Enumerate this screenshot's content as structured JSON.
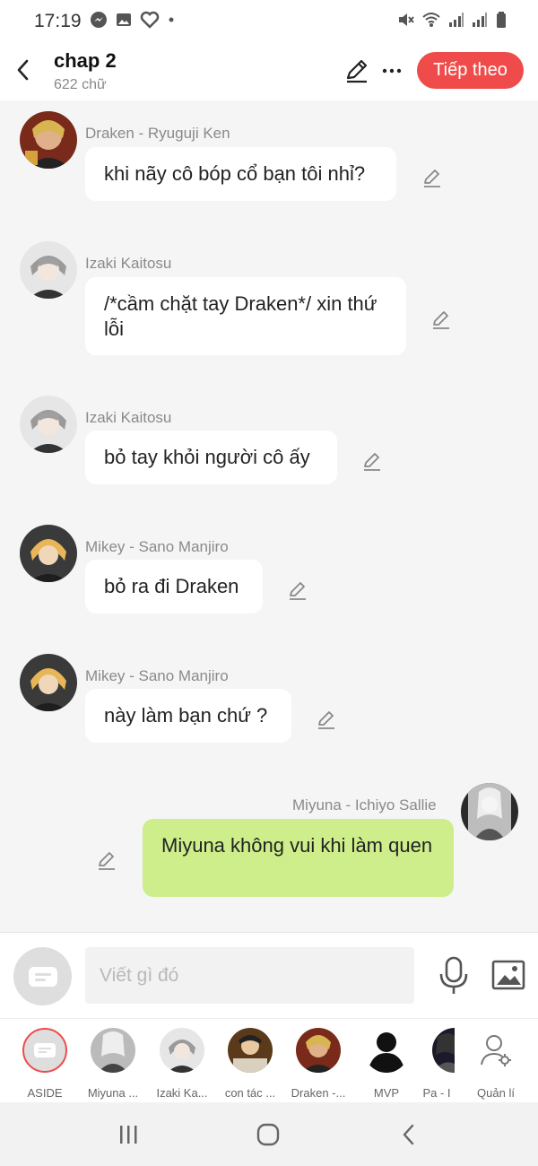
{
  "status_bar": {
    "time": "17:19"
  },
  "header": {
    "title": "chap 2",
    "word_count": "622 chữ",
    "next_label": "Tiếp theo"
  },
  "messages": [
    {
      "sender": "Draken - Ryuguji Ken",
      "text": "khi nãy cô bóp cổ bạn tôi nhỉ?",
      "avatar": "draken-avatar"
    },
    {
      "sender": "Izaki Kaitosu",
      "text": "/*cầm chặt tay Draken*/ xin thứ lỗi",
      "avatar": "izaki-avatar"
    },
    {
      "sender": "Izaki Kaitosu",
      "text": "bỏ tay khỏi người cô ấy",
      "avatar": "izaki-avatar"
    },
    {
      "sender": "Mikey - Sano Manjiro",
      "text": "bỏ ra đi Draken",
      "avatar": "mikey-avatar"
    },
    {
      "sender": "Mikey - Sano Manjiro",
      "text": "này làm bạn chứ ?",
      "avatar": "mikey-avatar"
    },
    {
      "sender": "Miyuna - Ichiyo Sallie",
      "text": "Miyuna không vui khi làm quen",
      "avatar": "miyuna-avatar"
    }
  ],
  "composer": {
    "placeholder": "Viết gì đó"
  },
  "characters": [
    {
      "label": "ASIDE"
    },
    {
      "label": "Miyuna ..."
    },
    {
      "label": "Izaki Ka..."
    },
    {
      "label": "con tác ..."
    },
    {
      "label": "Draken -..."
    },
    {
      "label": "MVP"
    },
    {
      "label": "Pa - I"
    },
    {
      "label": "Quản lí"
    }
  ],
  "colors": {
    "accent": "#f04b4b",
    "my_bubble": "#cdee8a",
    "other_bubble": "#ffffff",
    "background": "#f5f5f5"
  }
}
